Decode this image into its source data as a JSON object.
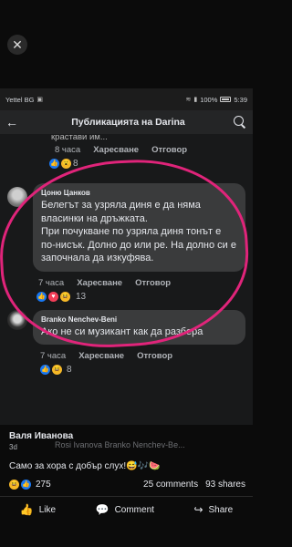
{
  "overlay_close": "✕",
  "statusbar": {
    "carrier": "Yettel BG",
    "battery": "100%",
    "time": "5:39"
  },
  "navbar": {
    "title": "Публикацията на Darina"
  },
  "prev_comment": {
    "cut_text": "крастави им...",
    "time": "8 часа",
    "like": "Харесване",
    "reply": "Отговор",
    "reactions_count": "8"
  },
  "comments": [
    {
      "name": "Цоню Цанков",
      "text": "Белегът за узряла диня е да няма власинки на дръжката.\nПри почукване по узряла диня тонът е по-нисък. Долно до или ре. На долно си е започнала да изкуфява.",
      "time": "7 часа",
      "like": "Харесване",
      "reply": "Отговор",
      "reactions_count": "13"
    },
    {
      "name": "Branko Nenchev-Beni",
      "text": "Ако не си музикант как да разбера",
      "time": "7 часа",
      "like": "Харесване",
      "reply": "Отговор",
      "reactions_count": "8"
    }
  ],
  "overlay": {
    "author": "Валя Иванова",
    "time": "3d",
    "ghost_text": "Rosi Ivanova  Branko Nenchev-Be...",
    "caption": "Само за хора с добър слух!😅🎶🍉",
    "reactions_count": "275",
    "comments": "25 comments",
    "shares": "93 shares",
    "like": "Like",
    "comment": "Comment",
    "share": "Share"
  }
}
